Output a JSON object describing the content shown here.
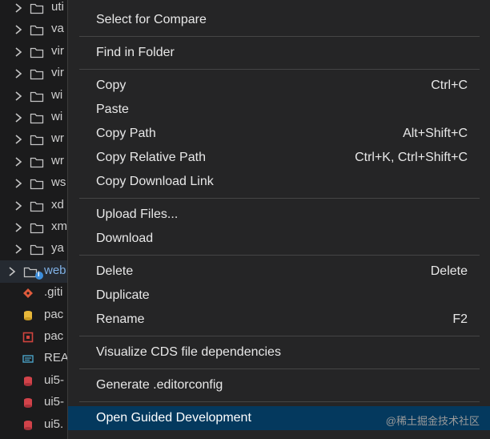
{
  "explorer": {
    "rows": [
      {
        "label": "uti",
        "type": "folder"
      },
      {
        "label": "va",
        "type": "folder"
      },
      {
        "label": "vir",
        "type": "folder"
      },
      {
        "label": "vir",
        "type": "folder"
      },
      {
        "label": "wi",
        "type": "folder"
      },
      {
        "label": "wi",
        "type": "folder"
      },
      {
        "label": "wr",
        "type": "folder"
      },
      {
        "label": "wr",
        "type": "folder"
      },
      {
        "label": "ws",
        "type": "folder"
      },
      {
        "label": "xd",
        "type": "folder"
      },
      {
        "label": "xm",
        "type": "folder"
      },
      {
        "label": "ya",
        "type": "folder"
      },
      {
        "label": "web",
        "type": "folder-selected"
      },
      {
        "label": ".giti",
        "type": "file-git"
      },
      {
        "label": "pac",
        "type": "file-db-yellow"
      },
      {
        "label": "pac",
        "type": "file-pkg-red"
      },
      {
        "label": "REA",
        "type": "file-readme"
      },
      {
        "label": "ui5-",
        "type": "file-db-red"
      },
      {
        "label": "ui5-",
        "type": "file-db-red"
      },
      {
        "label": "ui5.",
        "type": "file-db-red"
      }
    ]
  },
  "context_menu": {
    "groups": [
      [
        {
          "label": "Select for Compare",
          "shortcut": ""
        }
      ],
      [
        {
          "label": "Find in Folder",
          "shortcut": ""
        }
      ],
      [
        {
          "label": "Copy",
          "shortcut": "Ctrl+C"
        },
        {
          "label": "Paste",
          "shortcut": ""
        },
        {
          "label": "Copy Path",
          "shortcut": "Alt+Shift+C"
        },
        {
          "label": "Copy Relative Path",
          "shortcut": "Ctrl+K, Ctrl+Shift+C"
        },
        {
          "label": "Copy Download Link",
          "shortcut": ""
        }
      ],
      [
        {
          "label": "Upload Files...",
          "shortcut": ""
        },
        {
          "label": "Download",
          "shortcut": ""
        }
      ],
      [
        {
          "label": "Delete",
          "shortcut": "Delete"
        },
        {
          "label": "Duplicate",
          "shortcut": ""
        },
        {
          "label": "Rename",
          "shortcut": "F2"
        }
      ],
      [
        {
          "label": "Visualize CDS file dependencies",
          "shortcut": ""
        }
      ],
      [
        {
          "label": "Generate .editorconfig",
          "shortcut": ""
        }
      ],
      [
        {
          "label": "Open Guided Development",
          "shortcut": "",
          "highlighted": true
        }
      ]
    ],
    "watermark": "@稀土掘金技术社区"
  },
  "colors": {
    "menu_bg": "#252526",
    "highlight": "#04395e",
    "selected_label": "#7fb1e6"
  }
}
